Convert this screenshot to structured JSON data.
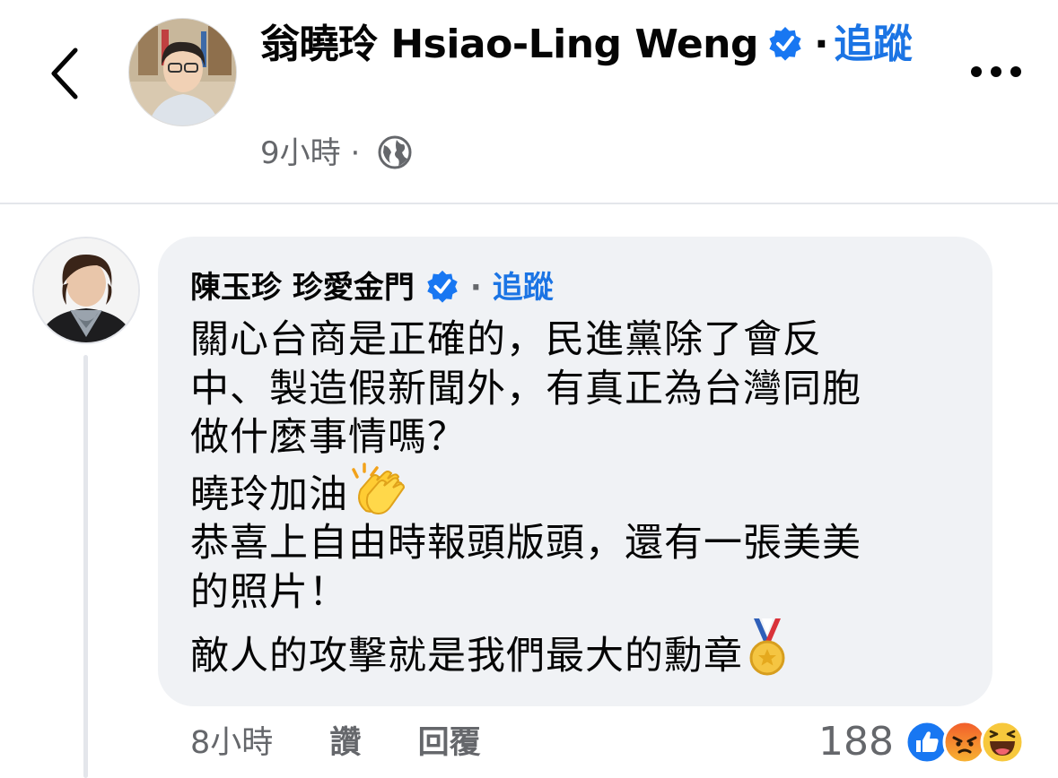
{
  "post_header": {
    "author_name": "翁曉玲 Hsiao-Ling  Weng",
    "separator": "·",
    "follow_label": "追蹤",
    "time": "9小時",
    "meta_separator": "·",
    "privacy_icon": "globe-icon",
    "back_icon": "chevron-left-icon",
    "more_icon": "more-horizontal-icon"
  },
  "comment": {
    "author_name": "陳玉珍 珍愛金門",
    "separator": "·",
    "follow_label": "追蹤",
    "lines": [
      "關心台商是正確的，民進黨除了會反",
      "中、製造假新聞外，有真正為台灣同胞",
      "做什麼事情嗎？",
      "曉玲加油",
      "恭喜上自由時報頭版頭，還有一張美美",
      "的照片！",
      "敵人的攻擊就是我們最大的勳章"
    ],
    "emojis": [
      "clapping-hands-icon",
      "medal-icon"
    ],
    "time": "8小時",
    "like_label": "讚",
    "reply_label": "回覆",
    "reaction_count": "188",
    "reactions": [
      "like-reaction-icon",
      "angry-reaction-icon",
      "haha-reaction-icon"
    ]
  },
  "colors": {
    "link_blue": "#1b74e4",
    "verified_blue": "#1877f2",
    "meta_gray": "#65676b",
    "bubble_bg": "#f0f2f5"
  }
}
